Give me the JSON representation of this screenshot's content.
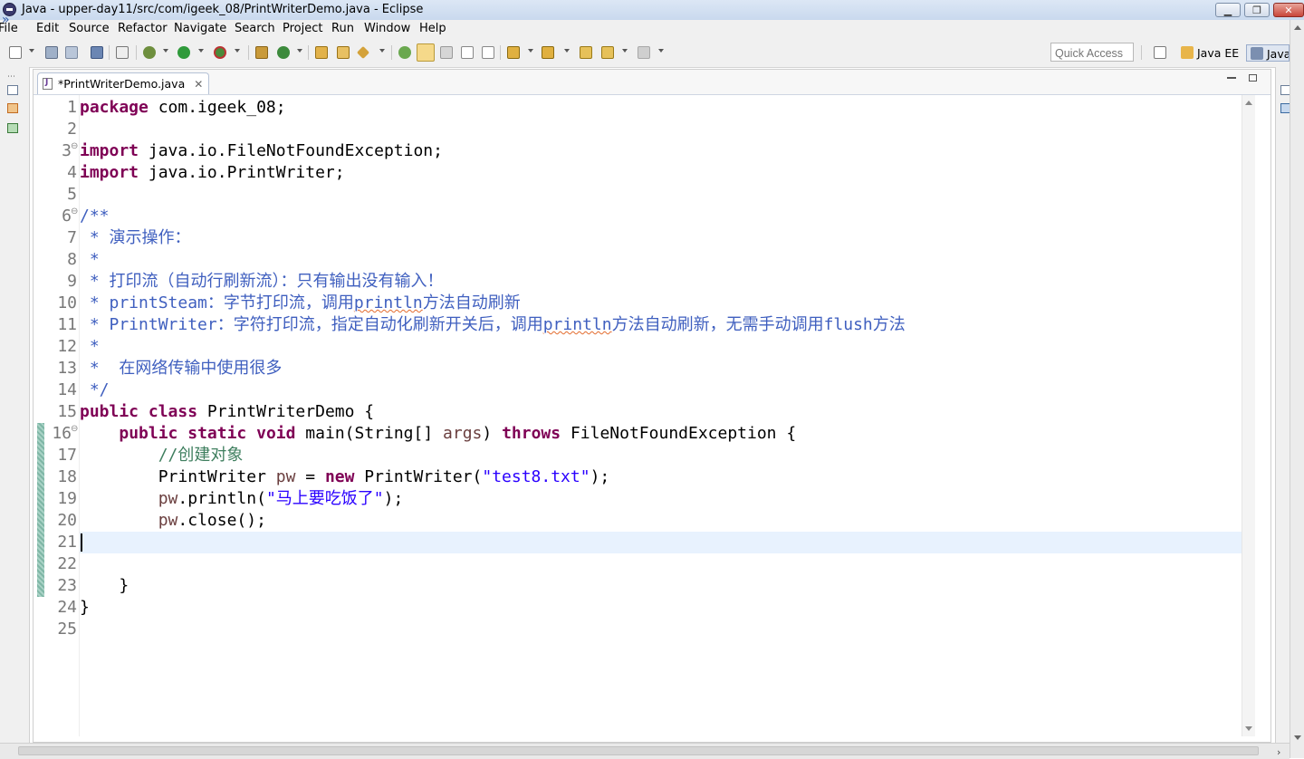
{
  "window": {
    "title": "Java - upper-day11/src/com/igeek_08/PrintWriterDemo.java - Eclipse",
    "controls": [
      "minimize",
      "maximize",
      "close"
    ]
  },
  "menu": [
    "File",
    "Edit",
    "Source",
    "Refactor",
    "Navigate",
    "Search",
    "Project",
    "Run",
    "Window",
    "Help"
  ],
  "toolbar": {
    "icons": [
      "new-icon",
      "save-icon",
      "save-all-icon",
      "print-icon",
      "skip-breakpoints-icon",
      "debug-icon",
      "run-icon",
      "external-tools-icon",
      "new-java-package-icon",
      "new-java-class-icon",
      "open-type-icon",
      "open-task-icon",
      "search-icon",
      "toggle-mark-occurrences-icon",
      "toggle-block-selection-icon",
      "show-whitespace-icon",
      "next-annotation-icon",
      "previous-annotation-icon",
      "last-edit-location-icon",
      "back-icon",
      "forward-icon"
    ],
    "quick_access_placeholder": "Quick Access",
    "perspectives": [
      "Java EE",
      "Java"
    ],
    "colors": {
      "active_perspective": "#dfe6f1"
    }
  },
  "editor": {
    "tab": {
      "label": "*PrintWriterDemo.java",
      "dirty": true
    },
    "current_line": 21,
    "lines": [
      {
        "num": "1",
        "fold": "",
        "segs": [
          [
            "kw",
            "package"
          ],
          [
            "",
            "com.igeek_08;"
          ]
        ]
      },
      {
        "num": "2",
        "fold": "",
        "segs": []
      },
      {
        "num": "3",
        "fold": "⊖",
        "segs": [
          [
            "kw",
            "import"
          ],
          [
            "",
            "java.io.FileNotFoundException;"
          ]
        ]
      },
      {
        "num": "4",
        "fold": "",
        "segs": [
          [
            "kw",
            "import"
          ],
          [
            "",
            "java.io.PrintWriter;"
          ]
        ]
      },
      {
        "num": "5",
        "fold": "",
        "segs": []
      },
      {
        "num": "6",
        "fold": "⊖",
        "segs": [
          [
            "doc",
            "/**"
          ]
        ]
      },
      {
        "num": "7",
        "fold": "",
        "segs": [
          [
            "doc",
            " * 演示操作："
          ]
        ]
      },
      {
        "num": "8",
        "fold": "",
        "segs": [
          [
            "doc",
            " *"
          ]
        ]
      },
      {
        "num": "9",
        "fold": "",
        "segs": [
          [
            "doc",
            " * 打印流（自动行刷新流）：只有输出没有输入！"
          ]
        ]
      },
      {
        "num": "10",
        "fold": "",
        "segs": [
          [
            "doc",
            " * printSteam：字节打印流，调用"
          ],
          [
            "doc wavy",
            "println"
          ],
          [
            "doc",
            "方法自动刷新"
          ]
        ]
      },
      {
        "num": "11",
        "fold": "",
        "segs": [
          [
            "doc",
            " * PrintWriter：字符打印流，指定自动化刷新开关后，调用"
          ],
          [
            "doc wavy",
            "println"
          ],
          [
            "doc",
            "方法自动刷新，无需手动调用flush方法"
          ]
        ]
      },
      {
        "num": "12",
        "fold": "",
        "segs": [
          [
            "doc",
            " *"
          ]
        ]
      },
      {
        "num": "13",
        "fold": "",
        "segs": [
          [
            "doc",
            " *  在网络传输中使用很多"
          ]
        ]
      },
      {
        "num": "14",
        "fold": "",
        "segs": [
          [
            "doc",
            " */"
          ]
        ]
      },
      {
        "num": "15",
        "fold": "",
        "segs": [
          [
            "kw",
            "public"
          ],
          [
            "",
            " "
          ],
          [
            "kw",
            "class"
          ],
          [
            "",
            "",
            " PrintWriterDemo {"
          ]
        ]
      },
      {
        "num": "16",
        "fold": "⊖",
        "segs": [
          [
            "",
            "    "
          ],
          [
            "kw",
            "public"
          ],
          [
            "",
            " "
          ],
          [
            "kw",
            "static"
          ],
          [
            "",
            " "
          ],
          [
            "kw",
            "void"
          ],
          [
            "",
            " main(String[] "
          ],
          [
            "var",
            "args"
          ],
          [
            "",
            ") "
          ],
          [
            "kw",
            "throws"
          ],
          [
            "",
            " FileNotFoundException {"
          ]
        ]
      },
      {
        "num": "17",
        "fold": "",
        "segs": [
          [
            "",
            "        "
          ],
          [
            "cmt",
            "//创建对象"
          ]
        ]
      },
      {
        "num": "18",
        "fold": "",
        "segs": [
          [
            "",
            "        PrintWriter "
          ],
          [
            "var",
            "pw"
          ],
          [
            "",
            " = "
          ],
          [
            "kw",
            "new"
          ],
          [
            "",
            " PrintWriter("
          ],
          [
            "str",
            "\"test8.txt\""
          ],
          [
            "",
            ");"
          ]
        ]
      },
      {
        "num": "19",
        "fold": "",
        "segs": [
          [
            "",
            "        "
          ],
          [
            "var",
            "pw"
          ],
          [
            "",
            ".println("
          ],
          [
            "str",
            "\"马上要吃饭了\""
          ],
          [
            "",
            ");"
          ]
        ]
      },
      {
        "num": "20",
        "fold": "",
        "segs": [
          [
            "",
            "        "
          ],
          [
            "var",
            "pw"
          ],
          [
            "",
            ".close();"
          ]
        ]
      },
      {
        "num": "21",
        "fold": "",
        "segs": []
      },
      {
        "num": "22",
        "fold": "",
        "segs": []
      },
      {
        "num": "23",
        "fold": "",
        "segs": [
          [
            "",
            "    }"
          ]
        ]
      },
      {
        "num": "24",
        "fold": "",
        "segs": [
          [
            "",
            "}"
          ]
        ]
      },
      {
        "num": "25",
        "fold": "",
        "segs": []
      }
    ],
    "colors": {
      "keyword": "#7f0055",
      "string": "#2a00ff",
      "comment": "#3f7f5f",
      "javadoc": "#3f5fbf",
      "local_variable": "#6a3e3e",
      "current_line_highlight": "#e8f2fe",
      "change_bar": "#7fb7a6"
    }
  }
}
